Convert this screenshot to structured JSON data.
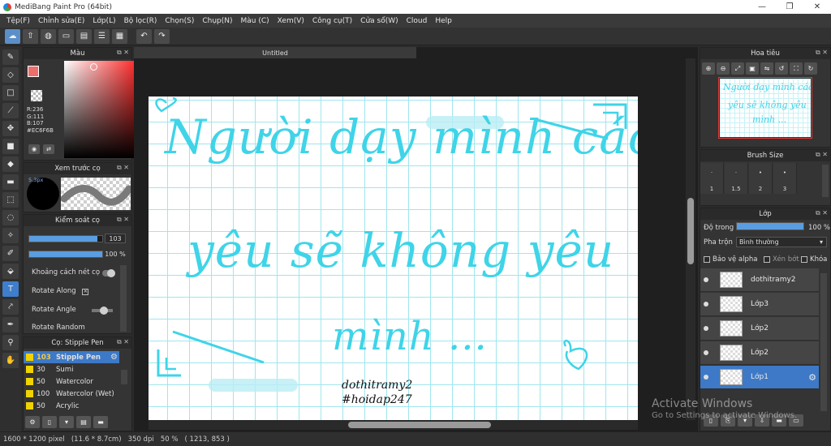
{
  "window": {
    "title": "MediBang Paint Pro (64bit)",
    "controls": [
      "—",
      "❐",
      "✕"
    ]
  },
  "menu": [
    "Tệp(F)",
    "Chỉnh sửa(E)",
    "Lớp(L)",
    "Bộ lọc(R)",
    "Chọn(S)",
    "Chụp(N)",
    "Màu (C)",
    "Xem(V)",
    "Công cụ(T)",
    "Cửa sổ(W)",
    "Cloud",
    "Help"
  ],
  "toolbar_icons": [
    "cloud-icon",
    "upload-icon",
    "chat-icon",
    "window-icon",
    "layout-icon",
    "list-icon",
    "grid-icon",
    "undo-icon",
    "redo-icon"
  ],
  "tools": [
    "brush-icon",
    "eraser-icon",
    "rectangle-icon",
    "line-icon",
    "move-icon",
    "fill-rect-icon",
    "bucket-icon",
    "gradient-icon",
    "select-icon",
    "lasso-icon",
    "magic-wand-icon",
    "select-pen-icon",
    "text-icon",
    "operation-icon",
    "dropper-icon",
    "hand-icon"
  ],
  "color_panel": {
    "title": "Màu",
    "r_label": "R:236",
    "g_label": "G:111",
    "b_label": "B:107",
    "hex_label": "#EC6F6B",
    "color": "#EC6F6B"
  },
  "brush_preview": {
    "title": "Xem trước cọ",
    "size_label": "5.3px"
  },
  "brush_control": {
    "title": "Kiểm soát cọ",
    "size_value": "103",
    "size_fraction": 0.93,
    "opacity_value": "100 %",
    "opacity_fraction": 1.0,
    "spacing_label": "Khoảng cách nét cọ",
    "rotate_along_label": "Rotate Along",
    "rotate_angle_label": "Rotate Angle",
    "rotate_random_label": "Rotate Random"
  },
  "brush_list": {
    "title": "Cọ: Stipple Pen",
    "items": [
      {
        "size": "103",
        "name": "Stipple Pen"
      },
      {
        "size": "30",
        "name": "Sumi"
      },
      {
        "size": "50",
        "name": "Watercolor"
      },
      {
        "size": "100",
        "name": "Watercolor (Wet)"
      },
      {
        "size": "50",
        "name": "Acrylic"
      }
    ]
  },
  "document": {
    "tab": "Untitled",
    "line1": "Người dạy mình cách",
    "line2": "yêu sẽ không yêu",
    "line3": "mình ...",
    "sig1": "dothitramy2",
    "sig2": "#hoidap247"
  },
  "navigator": {
    "title": "Hoa tiêu",
    "line1": "Người dạy mình cách",
    "line2": "yêu sẽ không yêu",
    "line3": "mình ..."
  },
  "brush_size": {
    "title": "Brush Size",
    "sizes": [
      "1",
      "1.5",
      "2",
      "3"
    ]
  },
  "layers": {
    "title": "Lớp",
    "opacity_label": "Độ trong",
    "opacity_value": "100 %",
    "blend_label": "Pha trộn",
    "blend_value": "Bình thường",
    "protect_alpha": "Bảo vệ alpha",
    "clipping": "Xén bớt",
    "lock": "Khóa",
    "items": [
      "dothitramy2",
      "Lớp3",
      "Lớp2",
      "Lớp2",
      "Lớp1"
    ],
    "selected_index": 4
  },
  "status": {
    "text": "1600 * 1200 pixel   (11.6 * 8.7cm)   350 dpi   50 %   ( 1213, 853 )"
  },
  "watermark": {
    "title": "Activate Windows",
    "subtitle": "Go to Settings to activate Windows."
  },
  "colors": {
    "accent": "#3d79c6",
    "ink": "#3fd4e8",
    "grid": "#9fe6ee"
  }
}
